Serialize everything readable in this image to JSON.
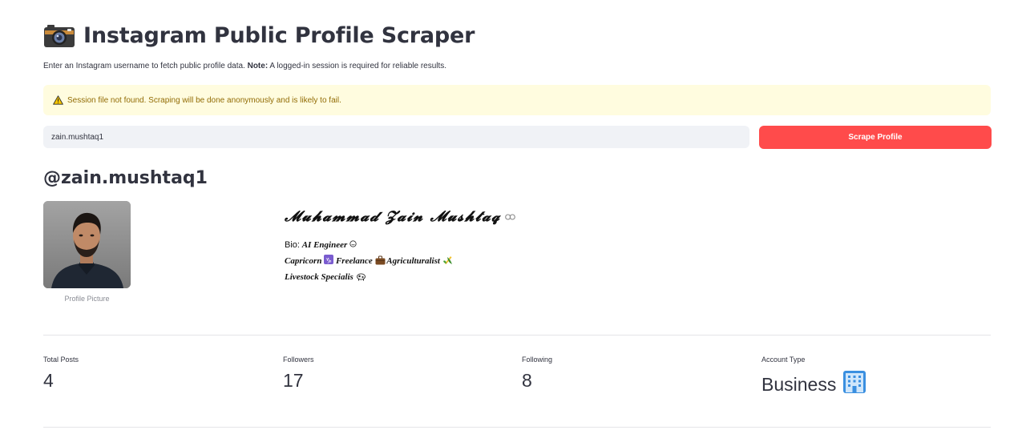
{
  "header": {
    "title": "Instagram Public Profile Scraper",
    "icon": "camera-icon"
  },
  "intro": {
    "text": "Enter an Instagram username to fetch public profile data.",
    "note_label": "Note:",
    "note_text": "A logged-in session is required for reliable results."
  },
  "warning": {
    "icon": "warning-icon",
    "text": "Session file not found. Scraping will be done anonymously and is likely to fail.",
    "background": "#fffcdf",
    "text_color": "#926c05"
  },
  "form": {
    "username_value": "zain.mushtaq1",
    "button_label": "Scrape Profile",
    "button_color": "#ff4b4b"
  },
  "profile": {
    "handle": "@zain.mushtaq1",
    "picture_caption": "Profile Picture",
    "full_name": "𝓜𝓾𝓱𝓪𝓶𝓶𝓪𝓭 𝓩𝓪𝓲𝓷 𝓜𝓾𝓼𝓱𝓽𝓪𝓺",
    "bio_label": "Bio:",
    "bio_line1": "AI Engineer",
    "bio_capricorn": "Capricorn",
    "bio_freelance": "Freelance",
    "bio_agri": "Agriculturalist",
    "bio_livestock": "Livestock Specialis"
  },
  "metrics": [
    {
      "label": "Total Posts",
      "value": "4"
    },
    {
      "label": "Followers",
      "value": "17"
    },
    {
      "label": "Following",
      "value": "8"
    },
    {
      "label": "Account Type",
      "value": "Business"
    }
  ]
}
